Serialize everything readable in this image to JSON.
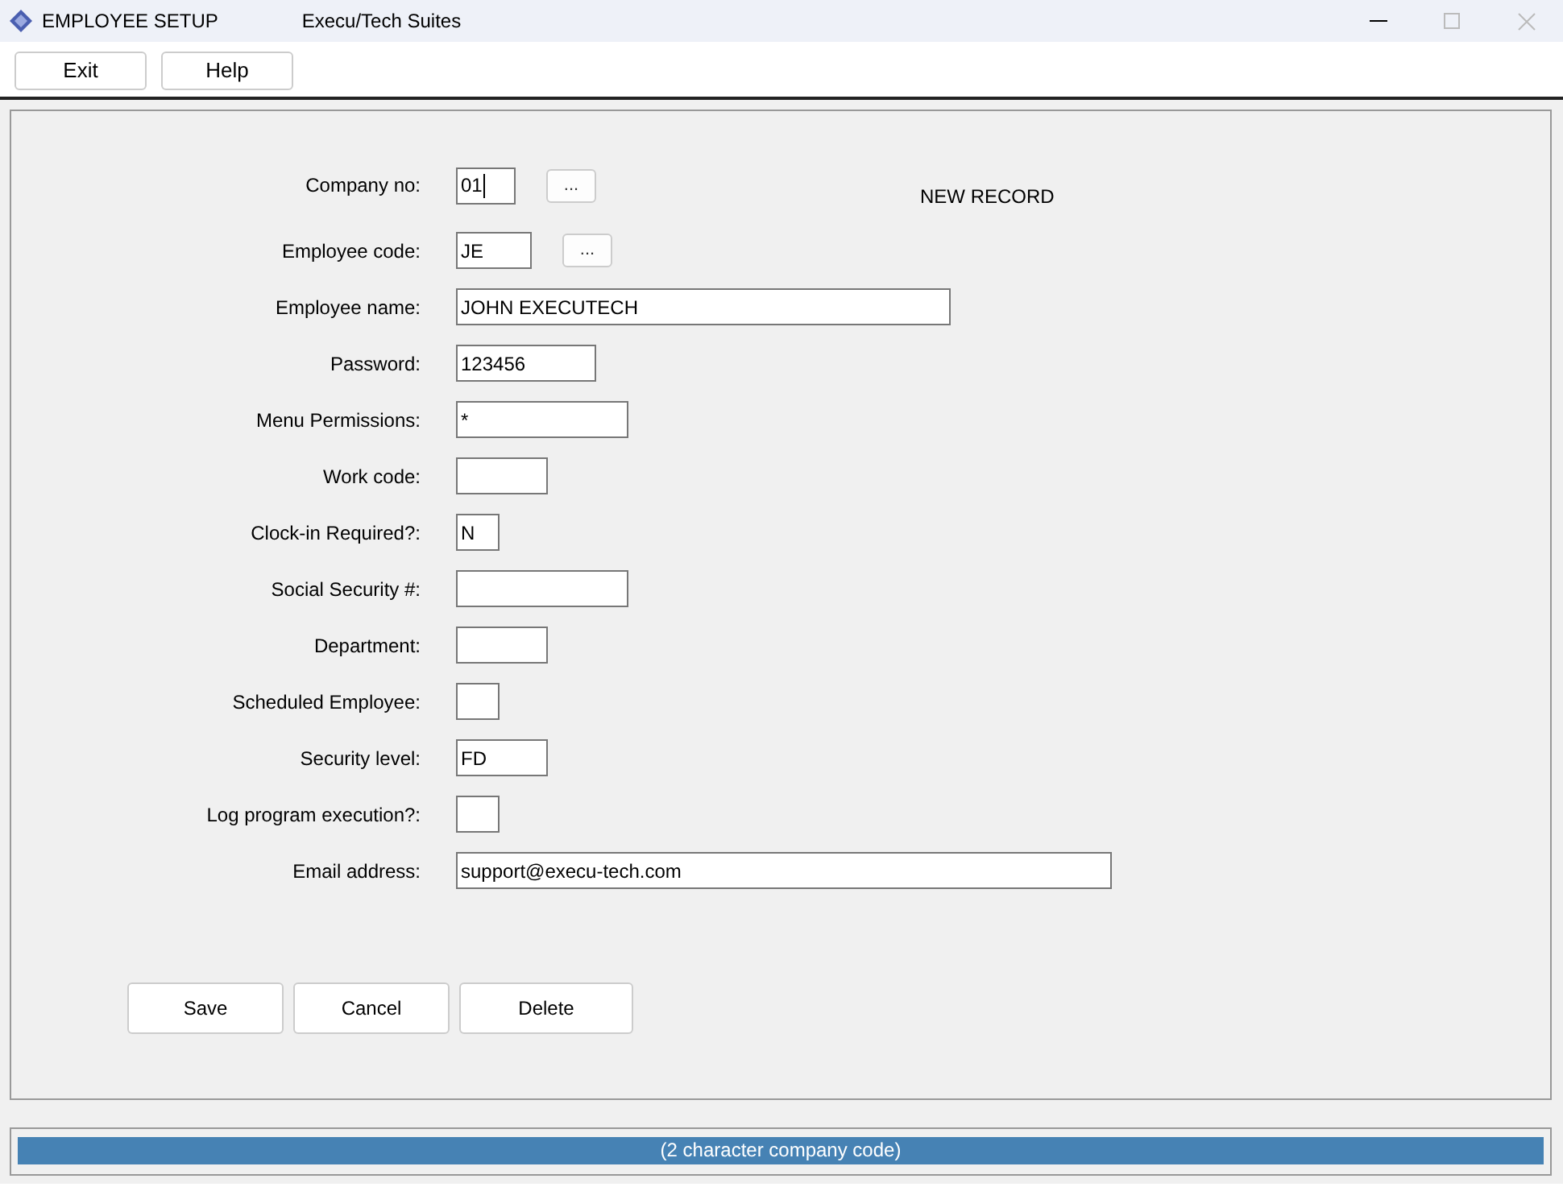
{
  "window": {
    "title": "EMPLOYEE SETUP",
    "subtitle": "Execu/Tech Suites"
  },
  "toolbar": [
    "Exit",
    "Help"
  ],
  "record_status": "NEW RECORD",
  "fields": [
    {
      "label": "Company no:",
      "value": "01",
      "focused": true,
      "lookup": "..."
    },
    {
      "label": "Employee code:",
      "value": "JE",
      "focused": false,
      "lookup": "..."
    },
    {
      "label": "Employee name:",
      "value": "JOHN EXECUTECH",
      "focused": false
    },
    {
      "label": "Password:",
      "value": "123456",
      "focused": false
    },
    {
      "label": "Menu Permissions:",
      "value": "*",
      "focused": false
    },
    {
      "label": "Work code:",
      "focused": false
    },
    {
      "label": "Clock-in Required?:",
      "value": "N",
      "focused": false
    },
    {
      "label": "Social Security #:",
      "focused": false
    },
    {
      "label": "Department:",
      "focused": false
    },
    {
      "label": "Scheduled Employee:",
      "focused": false
    },
    {
      "label": "Security level:",
      "value": "FD",
      "focused": false
    },
    {
      "label": "Log program execution?:",
      "focused": false
    },
    {
      "label": "Email address:",
      "value": "support@execu-tech.com",
      "focused": false
    }
  ],
  "actions": [
    "Save",
    "Cancel",
    "Delete"
  ],
  "status_bar": "(2 character company code)"
}
